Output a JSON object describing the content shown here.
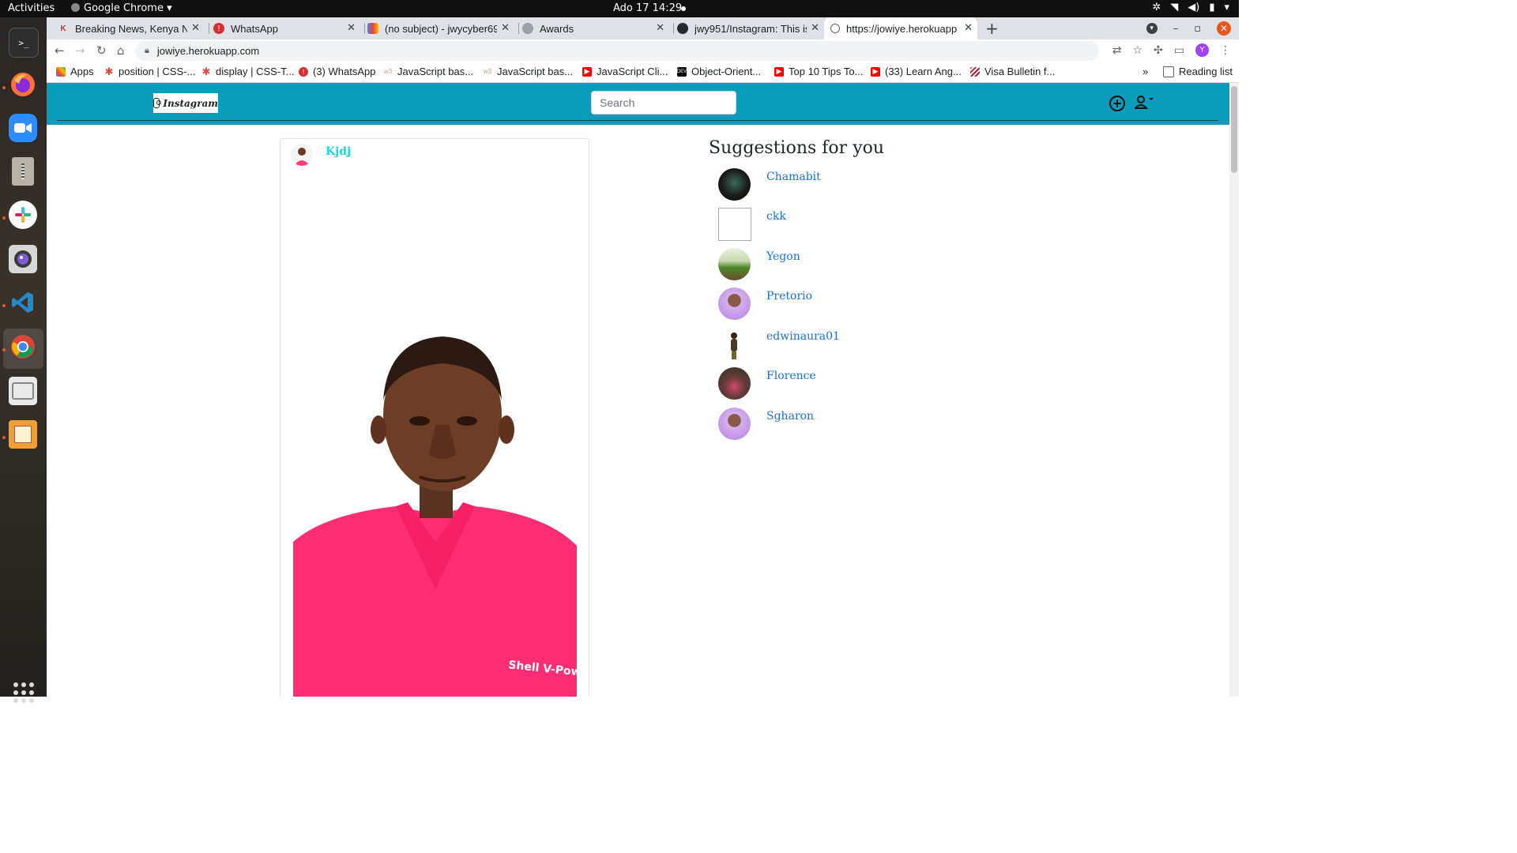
{
  "system_bar": {
    "activities": "Activities",
    "app_name": "Google Chrome",
    "clock": "Ado 17  14:29"
  },
  "dock": {
    "apps": [
      "terminal-icon",
      "firefox-icon",
      "zoom-icon",
      "archive-icon",
      "slack-icon",
      "camera-app-icon",
      "vscode-icon",
      "chrome-icon",
      "files-icon",
      "image-viewer-icon"
    ],
    "show_apps_icon": "grid-icon"
  },
  "tabs": [
    {
      "title": "Breaking News, Kenya Ne",
      "favicon": "news-icon",
      "color": "#d32f2f"
    },
    {
      "title": "WhatsApp",
      "favicon": "whatsapp-icon",
      "color": "#d32f2f"
    },
    {
      "title": "(no subject) - jwycyber69",
      "favicon": "gmail-icon",
      "color": "#ea4335"
    },
    {
      "title": "Awards",
      "favicon": "globe-icon",
      "color": "#9aa0a6"
    },
    {
      "title": "jwy951/Instagram: This is",
      "favicon": "github-icon",
      "color": "#24292e"
    },
    {
      "title": "https://jowiye.herokuapp",
      "favicon": "globe-icon",
      "color": "#5f6368"
    }
  ],
  "address_bar": {
    "url": "jowiye.herokuapp.com",
    "profile_initial": "Y"
  },
  "bookmarks": {
    "apps_label": "Apps",
    "items": [
      {
        "label": "position | CSS-...",
        "color": "#e8453c"
      },
      {
        "label": "display | CSS-T...",
        "color": "#e8453c"
      },
      {
        "label": "(3) WhatsApp",
        "color": "#d32f2f"
      },
      {
        "label": "JavaScript bas...",
        "color": "#c0a080"
      },
      {
        "label": "JavaScript bas...",
        "color": "#c0a080"
      },
      {
        "label": "JavaScript Cli...",
        "color": "#ff0000"
      },
      {
        "label": "Object-Orient...",
        "color": "#000000"
      },
      {
        "label": "Top 10 Tips To...",
        "color": "#ff0000"
      },
      {
        "label": "(33) Learn Ang...",
        "color": "#ff0000"
      },
      {
        "label": "Visa Bulletin f...",
        "color": "#b22234"
      }
    ],
    "overflow": "»",
    "reading_list": "Reading list"
  },
  "site": {
    "logo_text": "Instagram",
    "search_placeholder": "Search",
    "nav_color": "#0a9cbb",
    "post": {
      "username": "Kjdj",
      "image_caption": "Shell V-Power"
    },
    "suggestions_title": "Suggestions for you",
    "suggestions": [
      {
        "name": "Chamabit",
        "avatar": "dark"
      },
      {
        "name": "ckk",
        "avatar": "broken"
      },
      {
        "name": "Yegon",
        "avatar": "outdoor"
      },
      {
        "name": "Pretorio",
        "avatar": "purple"
      },
      {
        "name": "edwinaura01",
        "avatar": "standing"
      },
      {
        "name": "Florence",
        "avatar": "floral"
      },
      {
        "name": "Sgharon",
        "avatar": "purple"
      }
    ]
  }
}
